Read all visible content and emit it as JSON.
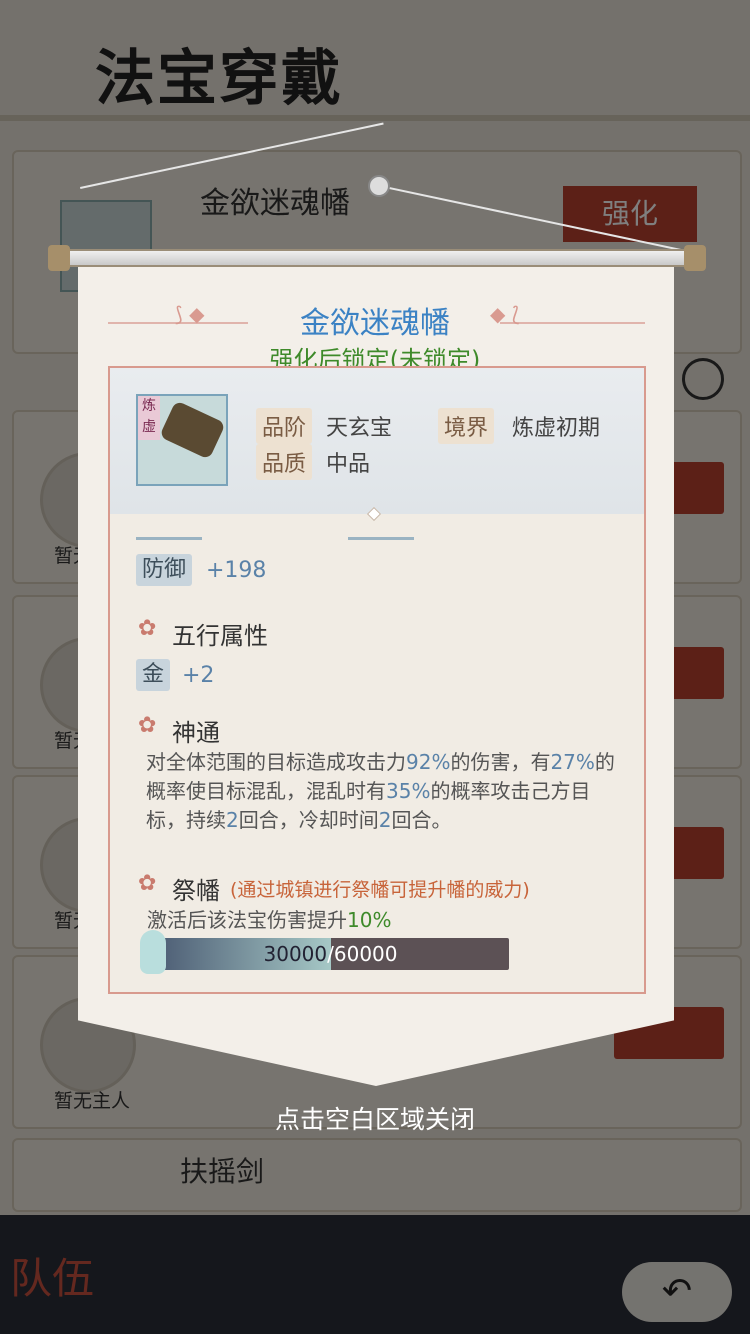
{
  "background": {
    "title": "法宝穿戴",
    "top_item_name": "金欲迷魂幡",
    "strengthen_button": "强化",
    "owner_labels": [
      "暂无主人",
      "暂无主人",
      "暂无主人",
      "暂无主人"
    ],
    "bottom_item_name": "扶摇剑",
    "team_label": "队伍",
    "back_icon": "back-arrow-icon"
  },
  "popup": {
    "title": "金欲迷魂幡",
    "lock_status": "强化后锁定(未锁定)",
    "grade_label": "品阶",
    "grade_value": "天玄宝",
    "realm_label": "境界",
    "realm_value": "炼虚初期",
    "quality_label": "品质",
    "quality_value": "中品",
    "item_tag": "炼虚",
    "defense_label": "防御",
    "defense_value": "+198",
    "five_elements_title": "五行属性",
    "element_label": "金",
    "element_value": "+2",
    "skill_title": "神通",
    "skill_desc_parts": [
      "对全体范围的目标造成攻击力",
      "92%",
      "的伤害，有",
      "27%",
      "的概率使目标混乱，混乱时有",
      "35%",
      "的概率攻击己方目标，持续",
      "2",
      "回合，冷却时间",
      "2",
      "回合。"
    ],
    "jifan_title": "祭幡",
    "jifan_note": "(通过城镇进行祭幡可提升幡的威力)",
    "jifan_desc": "激活后该法宝伤害提升",
    "jifan_pct": "10%",
    "progress_current": "30000",
    "progress_sep_max": "/60000",
    "progress_fraction": 0.5,
    "close_hint": "点击空白区域关闭"
  },
  "colors": {
    "title_blue": "#3b82c4",
    "lock_green": "#3e8a2a",
    "accent_red": "#b8402f"
  }
}
